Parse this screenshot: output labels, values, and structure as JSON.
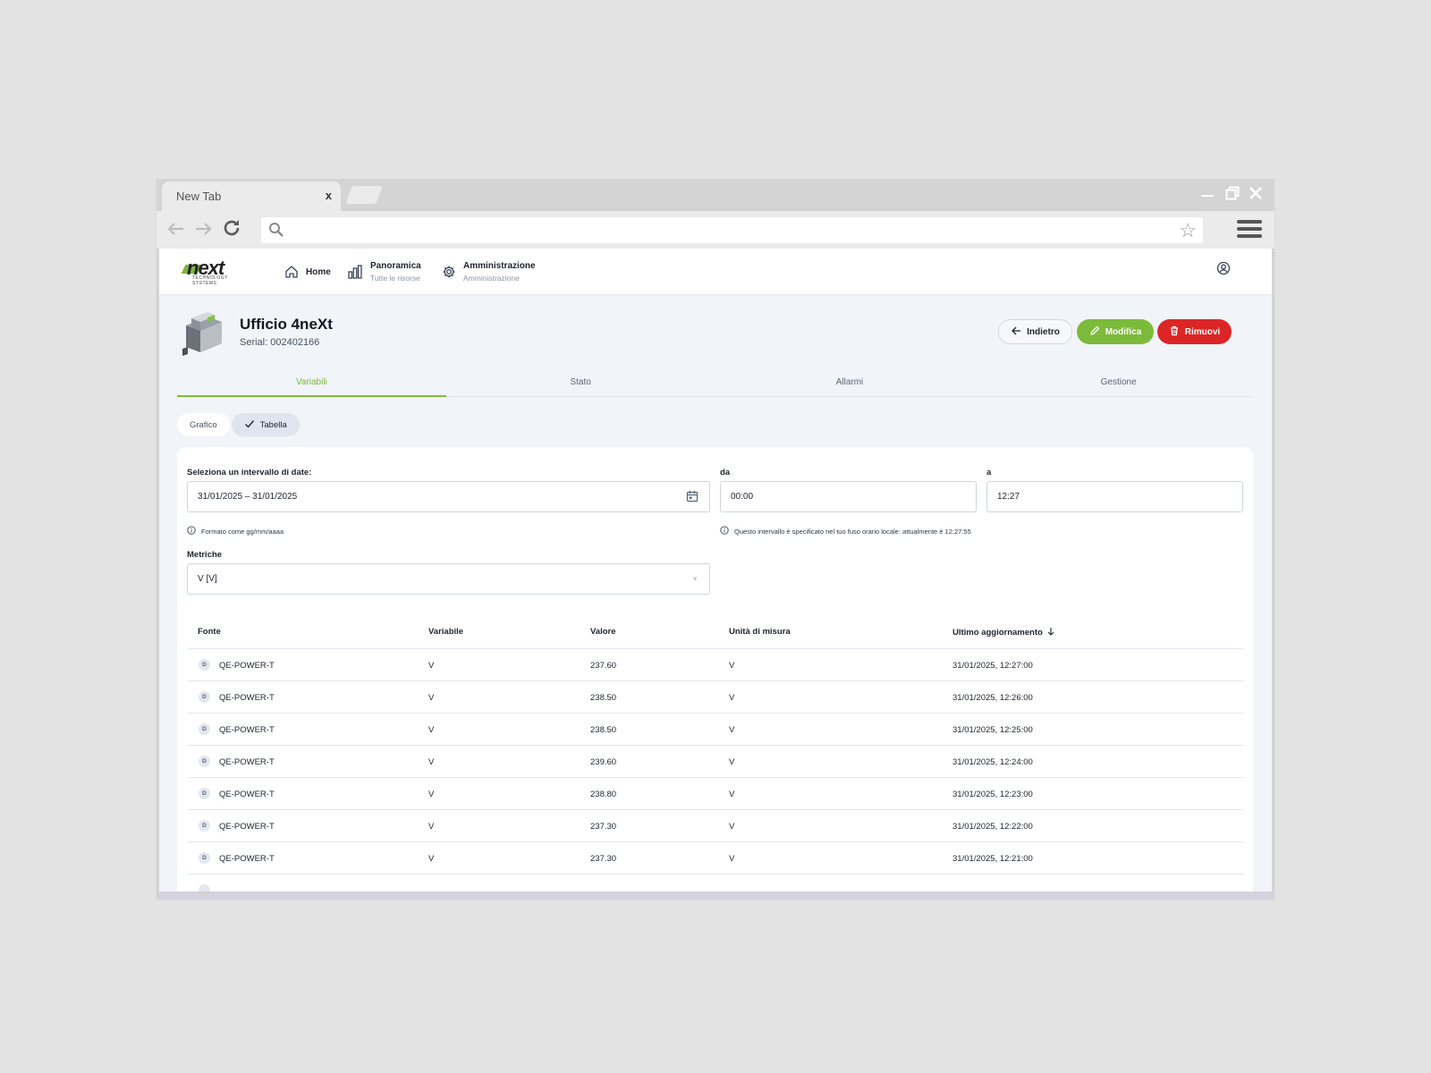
{
  "browser": {
    "tab_title": "New Tab",
    "tab_close": "x",
    "url": ""
  },
  "app": {
    "logo_text": "next",
    "logo_tagline": "TECHNOLOGY SYSTEMS",
    "nav": [
      {
        "label": "Home",
        "sub": ""
      },
      {
        "label": "Panoramica",
        "sub": "Tutte le risorse"
      },
      {
        "label": "Amministrazione",
        "sub": "Amministrazione"
      }
    ]
  },
  "device": {
    "title": "Ufficio 4neXt",
    "serial": "Serial: 002402166"
  },
  "actions": {
    "back": "Indietro",
    "edit": "Modifica",
    "remove": "Rimuovi"
  },
  "tabs": [
    "Variabili",
    "Stato",
    "Allarmi",
    "Gestione"
  ],
  "active_tab": "Variabili",
  "view_toggle": {
    "chart": "Grafico",
    "table": "Tabella",
    "selected": "Tabella"
  },
  "filters": {
    "date_range_label": "Seleziona un intervallo di date:",
    "date_range_value": "31/01/2025 – 31/01/2025",
    "date_hint": "Formato come gg/mm/aaaa",
    "from_label": "da",
    "from_value": "00:00",
    "to_label": "a",
    "to_value": "12:27",
    "time_hint": "Questo intervallo è specificato nel tuo fuso orario locale: attualmente è 12:27:55",
    "metrics_label": "Metriche",
    "metrics_value": "V [V]"
  },
  "table": {
    "headers": {
      "source": "Fonte",
      "variable": "Variabile",
      "value": "Valore",
      "unit": "Unità di misura",
      "updated": "Ultimo aggiornamento"
    },
    "rows": [
      {
        "badge": "D",
        "source": "QE-POWER-T",
        "variable": "V",
        "value": "237.60",
        "unit": "V",
        "updated": "31/01/2025, 12:27:00"
      },
      {
        "badge": "D",
        "source": "QE-POWER-T",
        "variable": "V",
        "value": "238.50",
        "unit": "V",
        "updated": "31/01/2025, 12:26:00"
      },
      {
        "badge": "D",
        "source": "QE-POWER-T",
        "variable": "V",
        "value": "238.50",
        "unit": "V",
        "updated": "31/01/2025, 12:25:00"
      },
      {
        "badge": "D",
        "source": "QE-POWER-T",
        "variable": "V",
        "value": "239.60",
        "unit": "V",
        "updated": "31/01/2025, 12:24:00"
      },
      {
        "badge": "D",
        "source": "QE-POWER-T",
        "variable": "V",
        "value": "238.80",
        "unit": "V",
        "updated": "31/01/2025, 12:23:00"
      },
      {
        "badge": "D",
        "source": "QE-POWER-T",
        "variable": "V",
        "value": "237.30",
        "unit": "V",
        "updated": "31/01/2025, 12:22:00"
      },
      {
        "badge": "D",
        "source": "QE-POWER-T",
        "variable": "V",
        "value": "237.30",
        "unit": "V",
        "updated": "31/01/2025, 12:21:00"
      }
    ]
  },
  "colors": {
    "accent": "#7cba3b",
    "danger": "#dc2626",
    "page_bg": "#f1f4f8"
  },
  "icons": {
    "home": "home-icon",
    "overview": "bar-chart-icon",
    "admin": "gear-icon",
    "user": "user-circle-icon",
    "back": "arrow-left-icon",
    "edit": "pencil-icon",
    "remove": "trash-icon",
    "calendar": "calendar-icon",
    "info": "info-icon",
    "sort": "arrow-down-icon",
    "check": "check-icon"
  }
}
